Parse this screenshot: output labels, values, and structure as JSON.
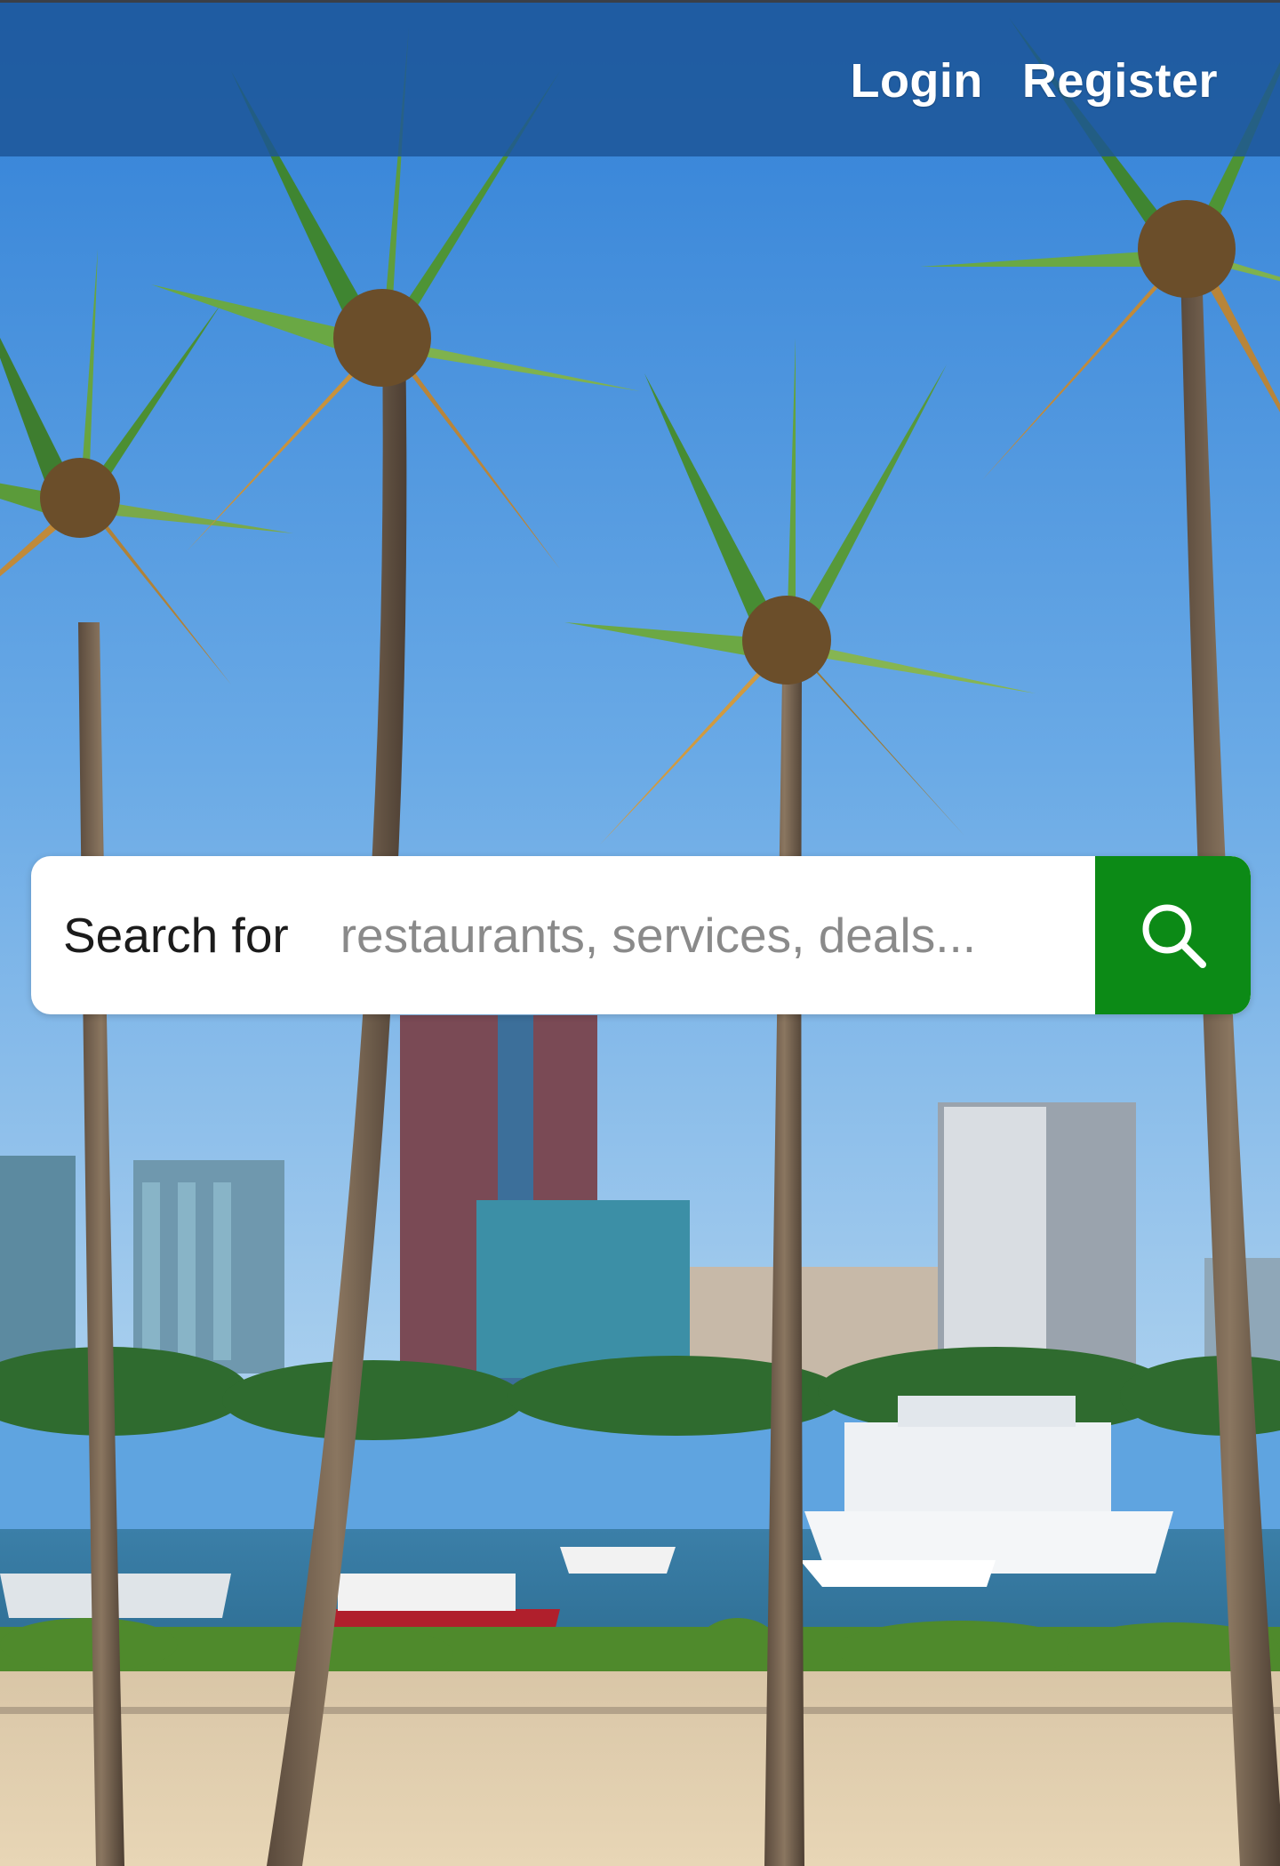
{
  "nav": {
    "login_label": "Login",
    "register_label": "Register"
  },
  "search": {
    "prefix_label": "Search for",
    "placeholder": "restaurants, services, deals...",
    "button_icon": "search-icon"
  },
  "colors": {
    "topbar": "#1c5496",
    "search_button": "#0c8a16",
    "sky": "#5fa4e0"
  }
}
